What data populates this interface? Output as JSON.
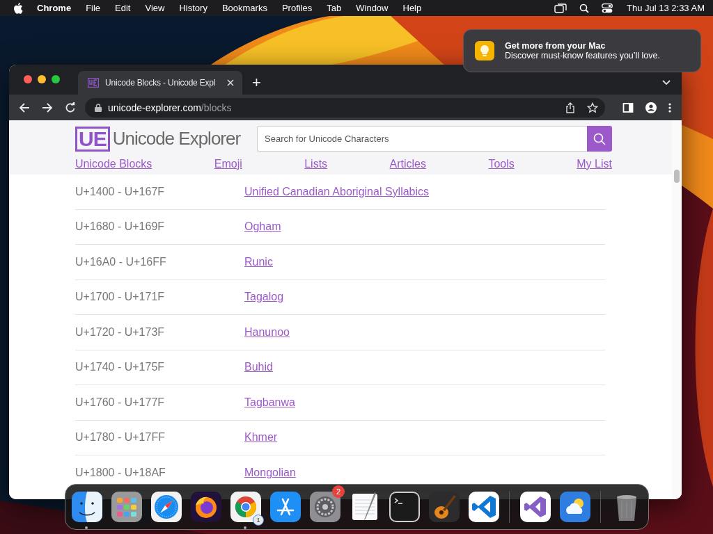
{
  "menu_bar": {
    "app": "Chrome",
    "menus": [
      "File",
      "Edit",
      "View",
      "History",
      "Bookmarks",
      "Profiles",
      "Tab",
      "Window",
      "Help"
    ],
    "clock": "Thu Jul 13  2:33 AM"
  },
  "notification": {
    "title": "Get more from your Mac",
    "body": "Discover must-know features you’ll love."
  },
  "browser": {
    "tabs": [
      {
        "title": "Unicode Blocks - Unicode Expl",
        "selected": true
      }
    ],
    "new_tab": "+",
    "address": {
      "host": "unicode-explorer.com",
      "path": "/blocks"
    }
  },
  "site": {
    "logo_mark": "UE",
    "logo_text": "Unicode Explorer",
    "search": {
      "placeholder": "Search for Unicode Characters"
    },
    "nav": [
      "Unicode Blocks",
      "Emoji",
      "Lists",
      "Articles",
      "Tools",
      "My List"
    ]
  },
  "blocks": [
    {
      "range": "U+1400 - U+167F",
      "name": "Unified Canadian Aboriginal Syllabics"
    },
    {
      "range": "U+1680 - U+169F",
      "name": "Ogham"
    },
    {
      "range": "U+16A0 - U+16FF",
      "name": "Runic"
    },
    {
      "range": "U+1700 - U+171F",
      "name": "Tagalog"
    },
    {
      "range": "U+1720 - U+173F",
      "name": "Hanunoo"
    },
    {
      "range": "U+1740 - U+175F",
      "name": "Buhid"
    },
    {
      "range": "U+1760 - U+177F",
      "name": "Tagbanwa"
    },
    {
      "range": "U+1780 - U+17FF",
      "name": "Khmer"
    },
    {
      "range": "U+1800 - U+18AF",
      "name": "Mongolian"
    }
  ],
  "dock": {
    "items": [
      {
        "kind": "finder",
        "running": true
      },
      {
        "kind": "launchpad",
        "running": false
      },
      {
        "kind": "safari",
        "running": false
      },
      {
        "kind": "firefox",
        "running": false
      },
      {
        "kind": "chrome",
        "running": true,
        "badge": "1"
      },
      {
        "kind": "appstore",
        "running": false
      },
      {
        "kind": "settings",
        "running": false,
        "badge": "2"
      },
      {
        "kind": "textedit",
        "running": false
      },
      {
        "kind": "terminal",
        "running": false
      },
      {
        "kind": "garageband",
        "running": false
      },
      {
        "kind": "vscode",
        "running": false
      },
      {
        "kind": "separator"
      },
      {
        "kind": "visualstudio",
        "running": false
      },
      {
        "kind": "weather",
        "running": false
      },
      {
        "kind": "separator"
      },
      {
        "kind": "trash",
        "running": false
      }
    ]
  }
}
